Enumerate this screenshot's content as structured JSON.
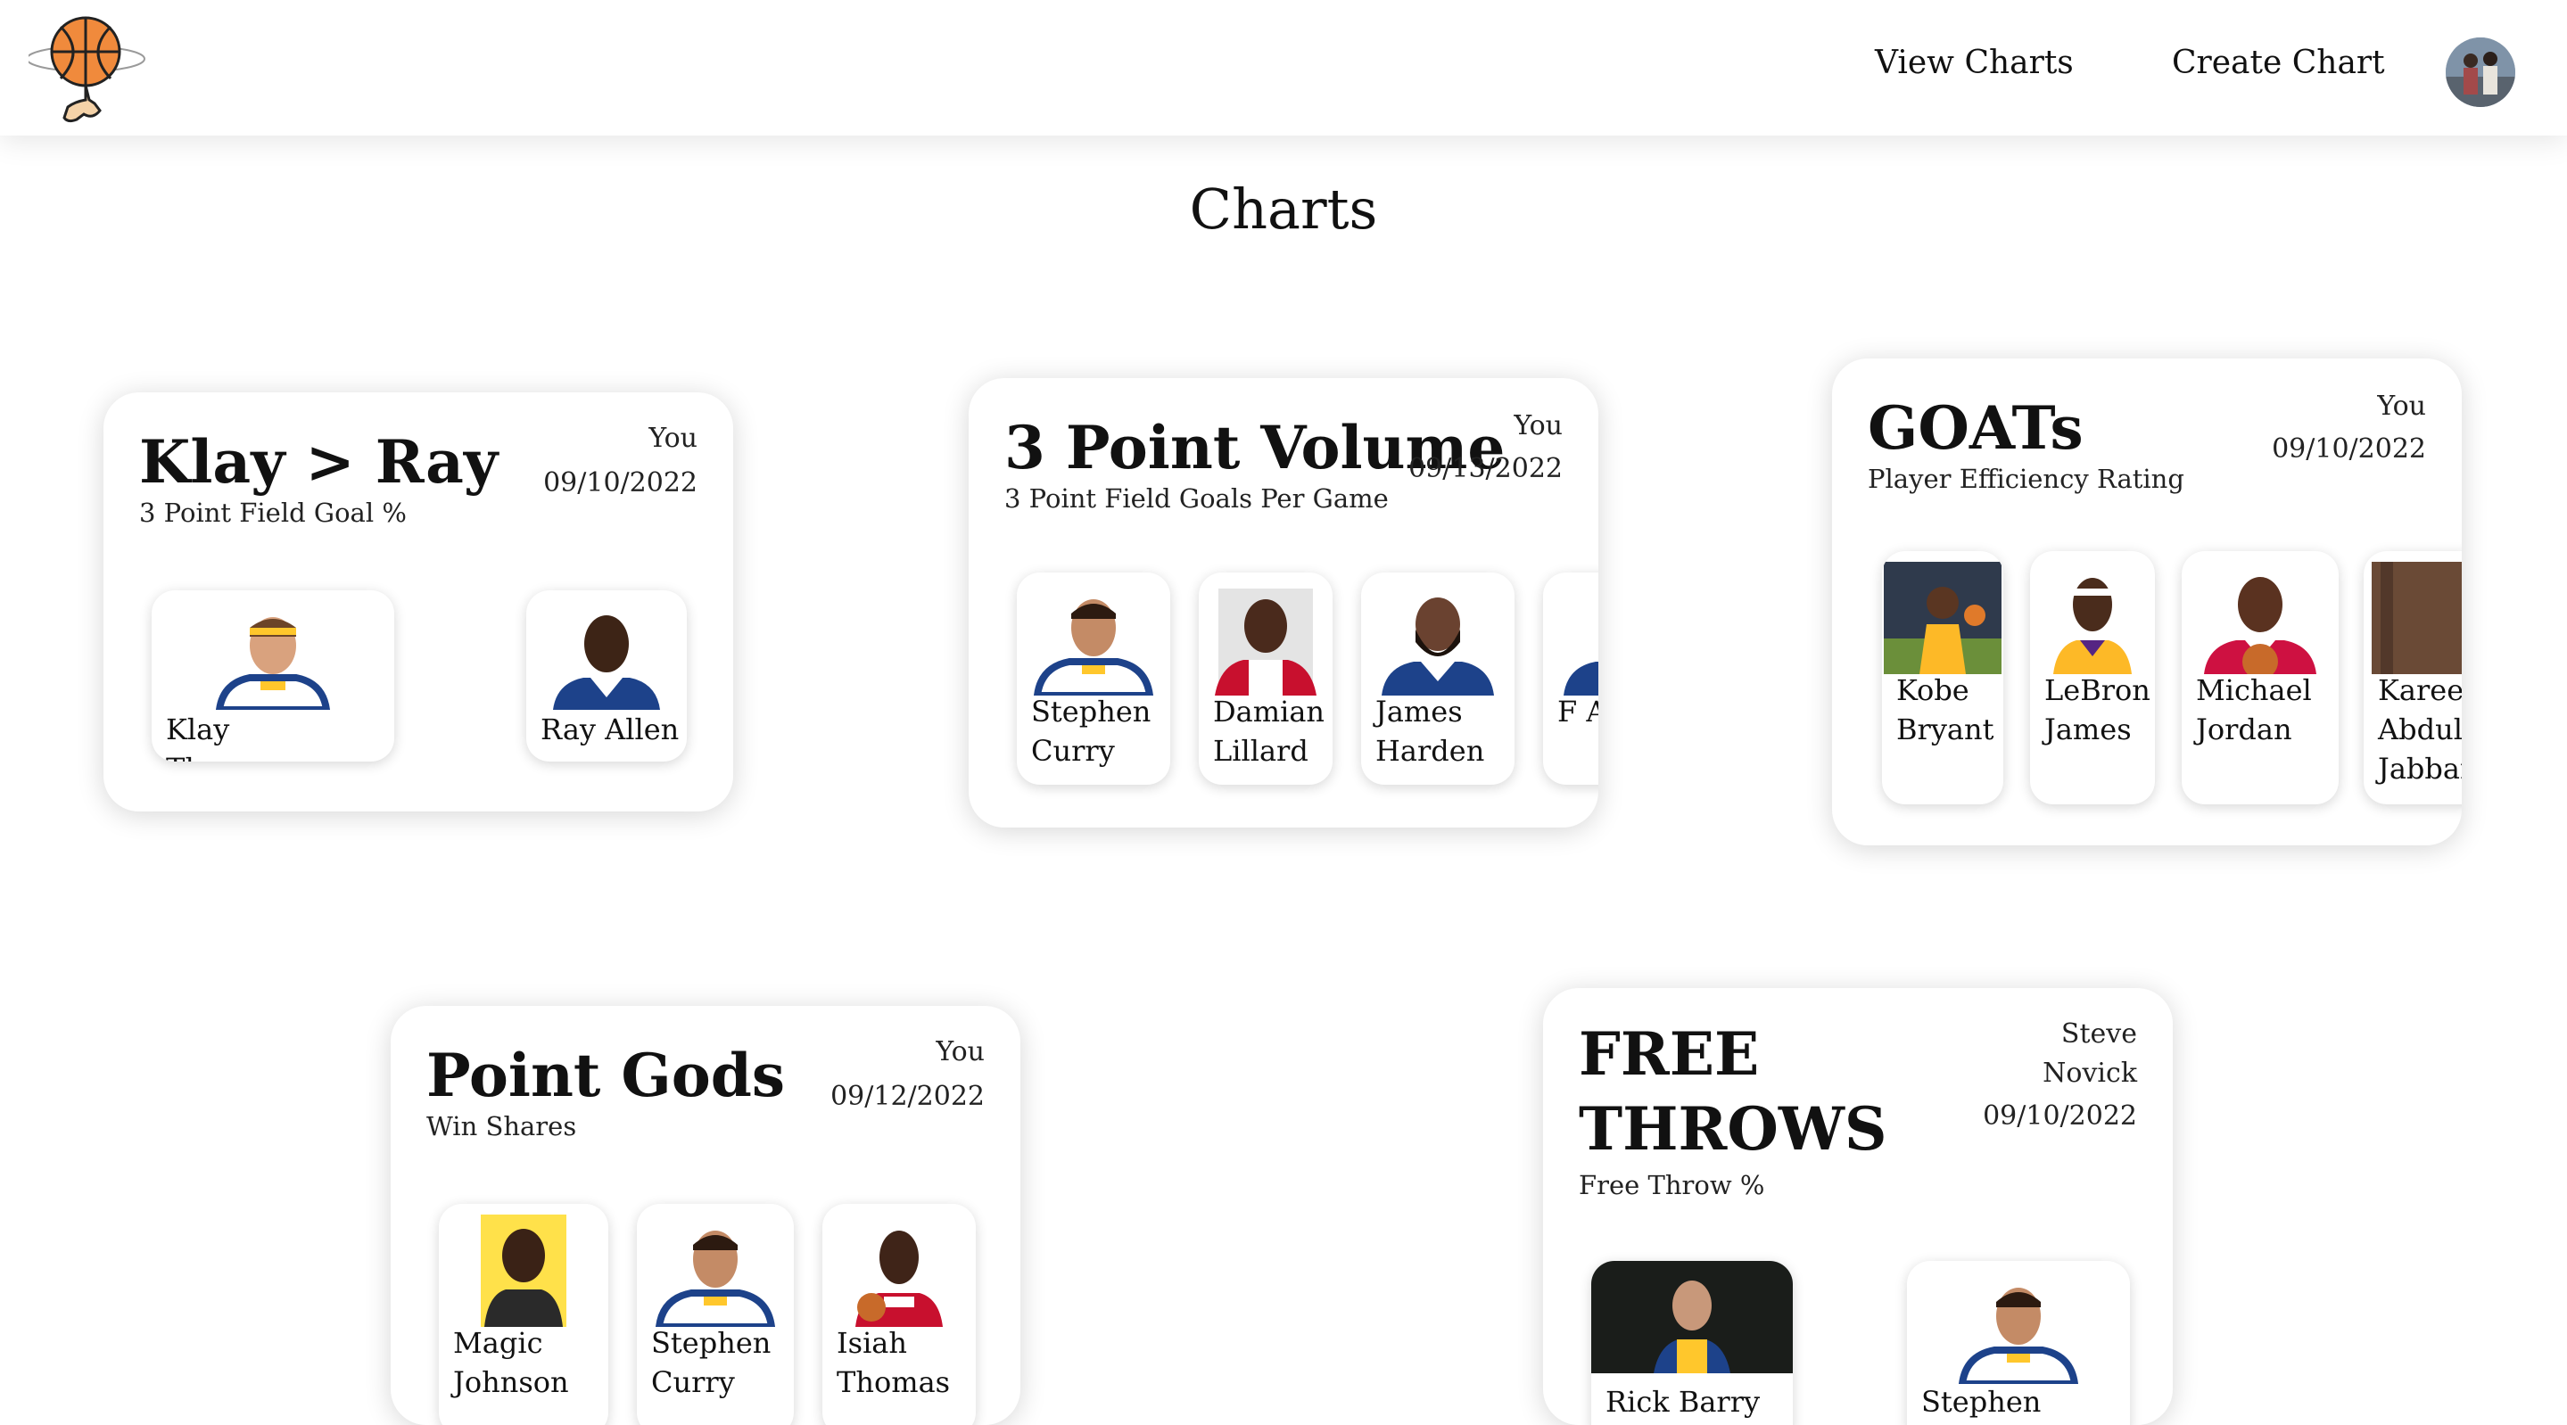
{
  "nav": {
    "view_charts": "View Charts",
    "create_chart": "Create Chart"
  },
  "page": {
    "title": "Charts"
  },
  "charts": [
    {
      "title": "Klay > Ray",
      "subtitle": "3 Point Field Goal %",
      "author": "You",
      "date": "09/10/2022",
      "players": [
        {
          "name": "Klay Thompson",
          "jersey": "warriors"
        },
        {
          "name": "Ray Allen",
          "jersey": "warriors"
        }
      ]
    },
    {
      "title": "3 Point Volume",
      "subtitle": "3 Point Field Goals Per Game",
      "author": "You",
      "date": "09/13/2022",
      "players": [
        {
          "name": "Stephen Curry",
          "jersey": "warriors"
        },
        {
          "name": "Damian Lillard",
          "jersey": "blazers"
        },
        {
          "name": "James Harden",
          "jersey": "sixers"
        },
        {
          "name": "F A",
          "jersey": "partial"
        }
      ]
    },
    {
      "title": "GOATs",
      "subtitle": "Player Efficiency Rating",
      "author": "You",
      "date": "09/10/2022",
      "players": [
        {
          "name": "Kobe Bryant",
          "jersey": "lakers"
        },
        {
          "name": "LeBron James",
          "jersey": "lakers"
        },
        {
          "name": "Michael Jordan",
          "jersey": "bulls"
        },
        {
          "name": "Kareem Abdul-Jabbar",
          "jersey": "partial"
        }
      ]
    },
    {
      "title": "Point Gods",
      "subtitle": "Win Shares",
      "author": "You",
      "date": "09/12/2022",
      "players": [
        {
          "name": "Magic Johnson",
          "jersey": "suit"
        },
        {
          "name": "Stephen Curry",
          "jersey": "warriors"
        },
        {
          "name": "Isiah Thomas",
          "jersey": "pistons"
        }
      ]
    },
    {
      "title": "FREE THROWS",
      "subtitle": "Free Throw %",
      "author": "Steve Novick",
      "date": "09/10/2022",
      "players": [
        {
          "name": "Rick Barry",
          "jersey": "warriors-retro"
        },
        {
          "name": "Stephen Curry",
          "jersey": "warriors"
        }
      ]
    }
  ],
  "colors": {
    "card_bg": "#ffffff",
    "ball": "#f08a3c",
    "warriors_blue": "#1d428a",
    "warriors_gold": "#ffc72c",
    "blazers_red": "#c8102e",
    "lakers_gold": "#fdb927",
    "bulls_red": "#ce1141"
  },
  "icons": {
    "logo": "basketball-spinning-on-finger-icon",
    "avatar": "user-avatar-photo"
  }
}
